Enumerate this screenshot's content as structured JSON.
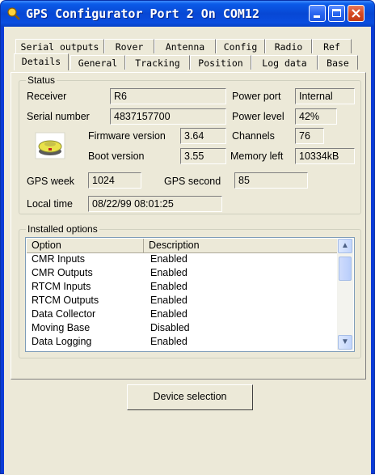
{
  "window": {
    "title": "GPS Configurator Port 2 On COM12"
  },
  "tabs": {
    "row1": [
      "Serial outputs",
      "Rover",
      "Antenna",
      "Config",
      "Radio",
      "Ref"
    ],
    "row2": [
      "Details",
      "General",
      "Tracking",
      "Position",
      "Log data",
      "Base"
    ],
    "active": "Details"
  },
  "status": {
    "group_label": "Status",
    "receiver_label": "Receiver",
    "receiver_value": "R6",
    "power_port_label": "Power port",
    "power_port_value": "Internal",
    "serial_label": "Serial number",
    "serial_value": "4837157700",
    "power_level_label": "Power level",
    "power_level_value": "42%",
    "firmware_label": "Firmware version",
    "firmware_value": "3.64",
    "channels_label": "Channels",
    "channels_value": "76",
    "boot_label": "Boot version",
    "boot_value": "3.55",
    "memory_label": "Memory left",
    "memory_value": "10334kB",
    "gps_week_label": "GPS week",
    "gps_week_value": "1024",
    "gps_second_label": "GPS second",
    "gps_second_value": "85",
    "local_time_label": "Local time",
    "local_time_value": "08/22/99 08:01:25"
  },
  "options": {
    "group_label": "Installed options",
    "col_option": "Option",
    "col_description": "Description",
    "rows": [
      {
        "option": "CMR Inputs",
        "description": "Enabled"
      },
      {
        "option": "CMR Outputs",
        "description": "Enabled"
      },
      {
        "option": "RTCM Inputs",
        "description": "Enabled"
      },
      {
        "option": "RTCM Outputs",
        "description": "Enabled"
      },
      {
        "option": "Data Collector",
        "description": "Enabled"
      },
      {
        "option": "Moving Base",
        "description": "Disabled"
      },
      {
        "option": "Data Logging",
        "description": "Enabled"
      }
    ]
  },
  "device_button_label": "Device selection",
  "icons": {
    "app": "satellite-search-icon",
    "receiver": "gps-receiver-icon"
  }
}
